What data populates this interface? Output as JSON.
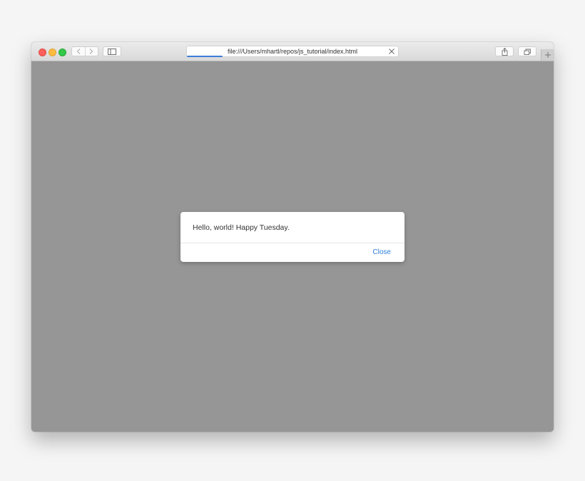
{
  "browser": {
    "url": "file:///Users/mhartl/repos/js_tutorial/index.html",
    "load_progress": 0.17,
    "accent_color": "#3c7dd9"
  },
  "dialog": {
    "message": "Hello, world! Happy Tuesday.",
    "close_label": "Close"
  },
  "icons": [
    "back-chevron-icon",
    "forward-chevron-icon",
    "sidebar-icon",
    "stop-icon",
    "share-icon",
    "tabs-overview-icon",
    "plus-icon"
  ]
}
